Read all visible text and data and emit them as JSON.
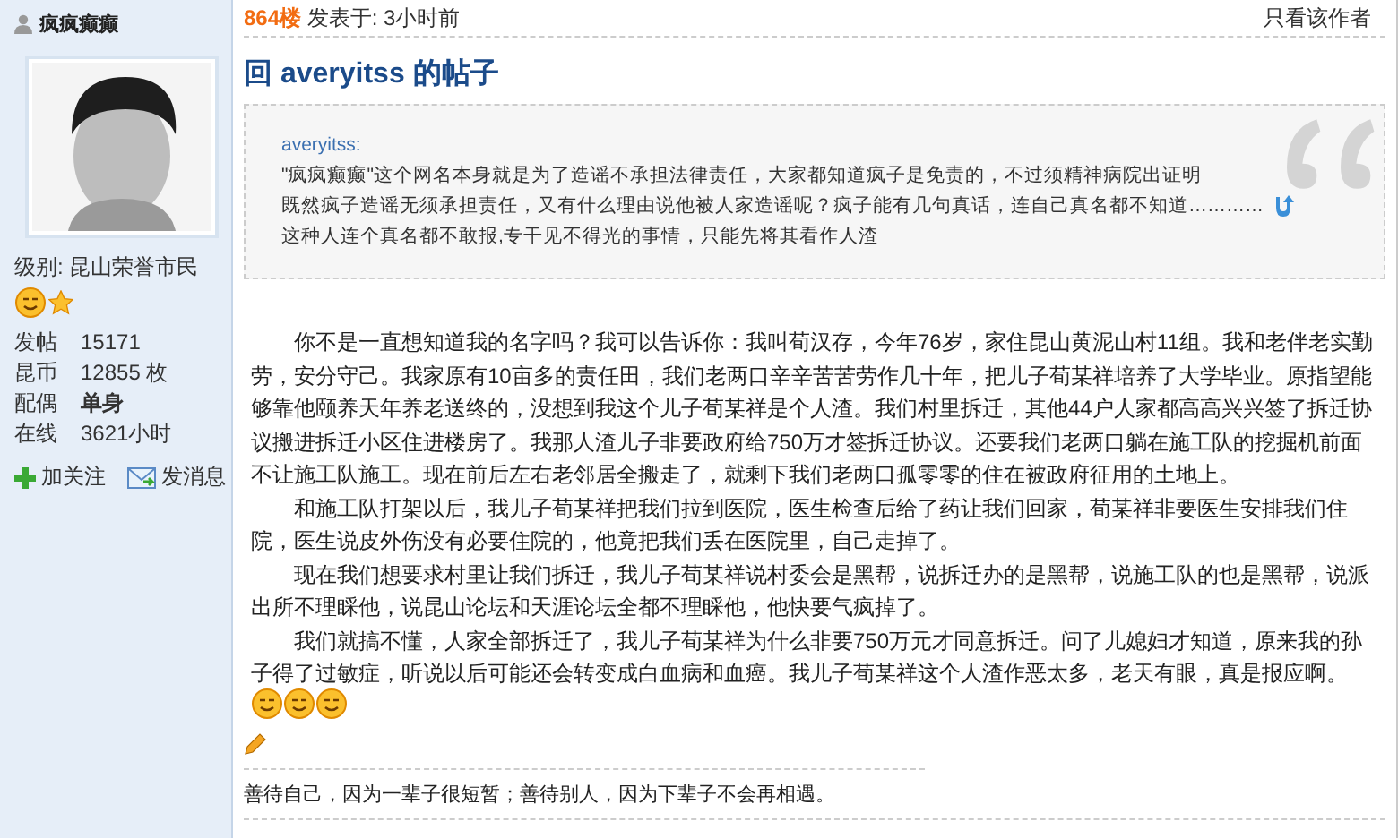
{
  "author": {
    "name": "疯疯癫癫",
    "level_label": "级别:",
    "level": "昆山荣誉市民",
    "stats": [
      {
        "label": "发帖",
        "value": "15171"
      },
      {
        "label": "昆币",
        "value": "12855 枚"
      },
      {
        "label": "配偶",
        "value": "单身",
        "bold": true
      },
      {
        "label": "在线",
        "value": "3621小时"
      }
    ],
    "actions": [
      {
        "kind": "follow",
        "label": "加关注"
      },
      {
        "kind": "message",
        "label": "发消息"
      }
    ]
  },
  "post": {
    "floor": "864楼",
    "posted": "发表于: 3小时前",
    "author_only": "只看该作者",
    "title": "回 averyitss 的帖子",
    "quote": {
      "author": "averyitss:",
      "lines": [
        "\"疯疯癫癫\"这个网名本身就是为了造谣不承担法律责任，大家都知道疯子是免责的，不过须精神病院出证明",
        "既然疯子造谣无须承担责任，又有什么理由说他被人家造谣呢？疯子能有几句真话，连自己真名都不知道…………",
        "这种人连个真名都不敢报,专干见不得光的事情，只能先将其看作人渣"
      ]
    },
    "paragraphs": [
      "你不是一直想知道我的名字吗？我可以告诉你：我叫荀汉存，今年76岁，家住昆山黄泥山村11组。我和老伴老实勤劳，安分守己。我家原有10亩多的责任田，我们老两口辛辛苦苦劳作几十年，把儿子荀某祥培养了大学毕业。原指望能够靠他颐养天年养老送终的，没想到我这个儿子荀某祥是个人渣。我们村里拆迁，其他44户人家都高高兴兴签了拆迁协议搬进拆迁小区住进楼房了。我那人渣儿子非要政府给750万才签拆迁协议。还要我们老两口躺在施工队的挖掘机前面不让施工队施工。现在前后左右老邻居全搬走了，就剩下我们老两口孤零零的住在被政府征用的土地上。",
      "和施工队打架以后，我儿子荀某祥把我们拉到医院，医生检查后给了药让我们回家，荀某祥非要医生安排我们住院，医生说皮外伤没有必要住院的，他竟把我们丢在医院里，自己走掉了。",
      "现在我们想要求村里让我们拆迁，我儿子荀某祥说村委会是黑帮，说拆迁办的是黑帮，说施工队的也是黑帮，说派出所不理睬他，说昆山论坛和天涯论坛全都不理睬他，他快要气疯掉了。",
      "我们就搞不懂，人家全部拆迁了，我儿子荀某祥为什么非要750万元才同意拆迁。问了儿媳妇才知道，原来我的孙子得了过敏症，听说以后可能还会转变成白血病和血癌。我儿子荀某祥这个人渣作恶太多，老天有眼，真是报应啊。"
    ],
    "emoticons": [
      {
        "kind": "grin"
      },
      {
        "kind": "grin"
      },
      {
        "kind": "grin"
      }
    ],
    "signature": "善待自己，因为一辈子很短暂；善待别人，因为下辈子不会再相遇。"
  }
}
